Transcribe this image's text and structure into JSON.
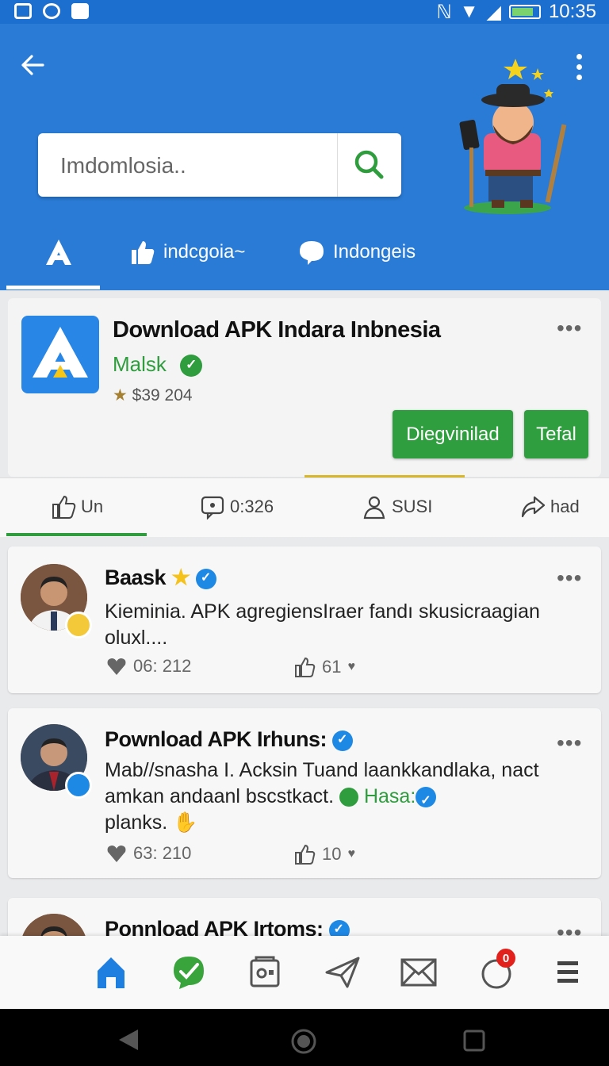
{
  "status_bar": {
    "time": "10:35"
  },
  "header": {
    "search": {
      "placeholder": "Imdomlosia.."
    },
    "tabs": [
      {
        "label": ""
      },
      {
        "label": "indcgoia~"
      },
      {
        "label": "Indongeis"
      }
    ]
  },
  "app": {
    "title": "Download APK Indara Inbnesia",
    "developer": "Malsk",
    "rating": "$39 204",
    "primary_button": "Diegvinilad",
    "secondary_button": "Tefal"
  },
  "actions": [
    {
      "label": "Un"
    },
    {
      "label": "0:326"
    },
    {
      "label": "SUSI"
    },
    {
      "label": "had"
    }
  ],
  "posts": [
    {
      "author": "Baask",
      "text": "Kieminia. APK agregiensIraer fandı skusicraagian oluxl....",
      "views": "06: 212",
      "likes": "61"
    },
    {
      "author": "Pownload APK Irhuns:",
      "text": "Mab//snasha I. Acksin Tuand laankkandlaka, nact amkan andaanl bscstkact.",
      "tag": "Hasa:",
      "text_end": "planks.",
      "views": "63: 210",
      "likes": "10"
    },
    {
      "author": "Ponnload APK Irtoms:"
    }
  ],
  "bottom_nav": {
    "notification_count": "0"
  },
  "colors": {
    "header_blue": "#2a7bd6",
    "accent_green": "#2f9e3e",
    "verify_blue": "#1e88e5"
  }
}
